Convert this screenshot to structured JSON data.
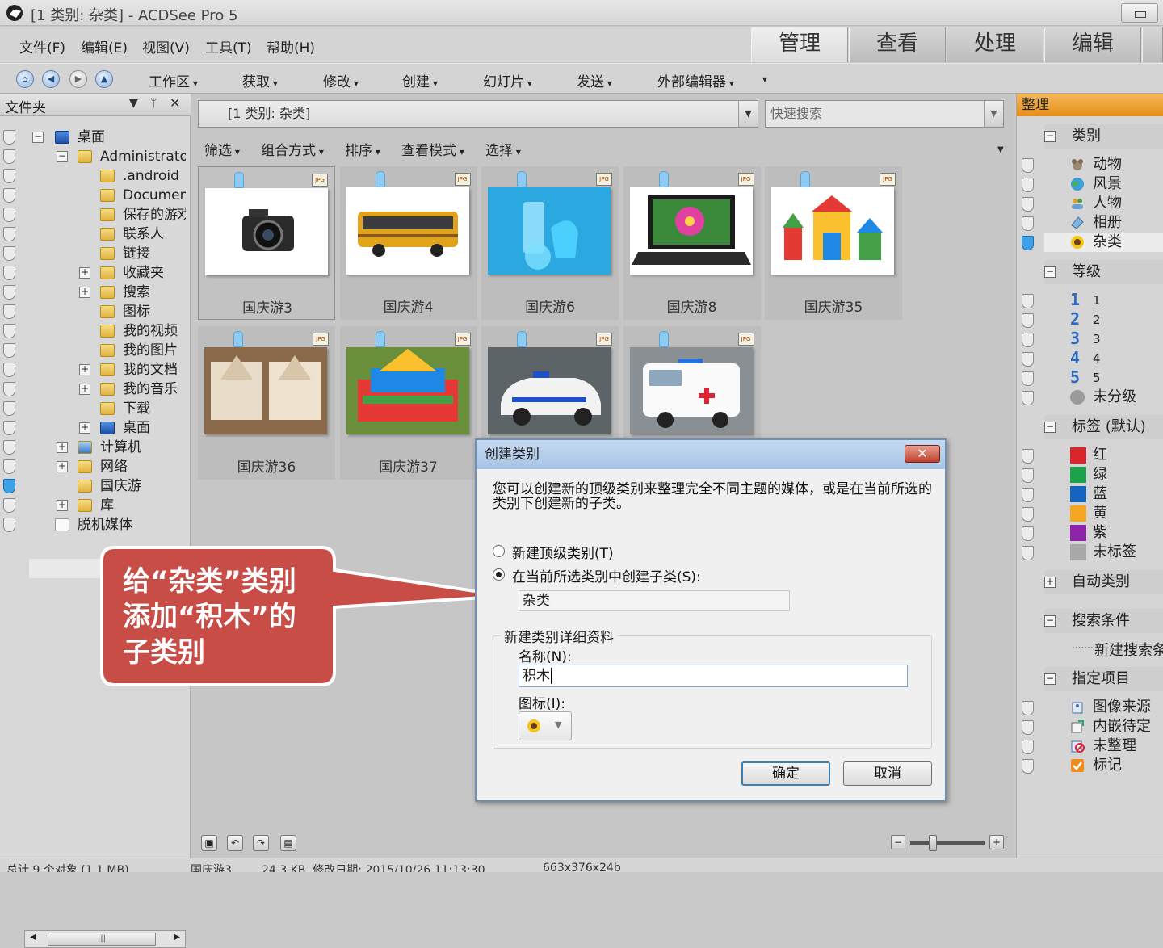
{
  "window": {
    "title": "[1 类别: 杂类] - ACDSee Pro 5"
  },
  "menu": [
    "文件(F)",
    "编辑(E)",
    "视图(V)",
    "工具(T)",
    "帮助(H)"
  ],
  "mode_tabs": [
    "管理",
    "查看",
    "处理",
    "编辑"
  ],
  "toolbar": [
    "工作区",
    "获取",
    "修改",
    "创建",
    "幻灯片",
    "发送",
    "外部编辑器"
  ],
  "folder_panel": {
    "title": "文件夹",
    "tree": [
      {
        "label": "桌面"
      },
      {
        "label": "Administrator"
      },
      {
        "label": ".android"
      },
      {
        "label": "Documents"
      },
      {
        "label": "保存的游戏"
      },
      {
        "label": "联系人"
      },
      {
        "label": "链接"
      },
      {
        "label": "收藏夹"
      },
      {
        "label": "搜索"
      },
      {
        "label": "图标"
      },
      {
        "label": "我的视频"
      },
      {
        "label": "我的图片"
      },
      {
        "label": "我的文档"
      },
      {
        "label": "我的音乐"
      },
      {
        "label": "下载"
      },
      {
        "label": "桌面"
      },
      {
        "label": "计算机"
      },
      {
        "label": "网络"
      },
      {
        "label": "国庆游"
      },
      {
        "label": "库"
      },
      {
        "label": "脱机媒体"
      }
    ]
  },
  "browser": {
    "path": "[1 类别: 杂类]",
    "quicksearch_placeholder": "快速搜索",
    "filters": [
      "筛选",
      "组合方式",
      "排序",
      "查看模式",
      "选择"
    ],
    "thumb_badge": "JPG",
    "thumbnails": [
      {
        "name": "国庆游3",
        "subject": "camera"
      },
      {
        "name": "国庆游4",
        "subject": "bus"
      },
      {
        "name": "国庆游6",
        "subject": "glassware"
      },
      {
        "name": "国庆游8",
        "subject": "laptop"
      },
      {
        "name": "国庆游35",
        "subject": "building-blocks"
      },
      {
        "name": "国庆游36",
        "subject": "carvings"
      },
      {
        "name": "国庆游37",
        "subject": "block-model"
      },
      {
        "name": "",
        "subject": "police-car"
      },
      {
        "name": "",
        "subject": "ambulance"
      }
    ]
  },
  "organize_panel": {
    "title": "整理",
    "sections": {
      "categories": {
        "label": "类别",
        "items": [
          "动物",
          "风景",
          "人物",
          "相册",
          "杂类"
        ]
      },
      "ratings": {
        "label": "等级",
        "items": [
          "1",
          "2",
          "3",
          "4",
          "5"
        ],
        "unrated": "未分级"
      },
      "labels": {
        "label": "标签 (默认)",
        "items": [
          {
            "name": "红",
            "color": "#d9262b"
          },
          {
            "name": "绿",
            "color": "#1aa34a"
          },
          {
            "name": "蓝",
            "color": "#1565c0"
          },
          {
            "name": "黄",
            "color": "#f5a623"
          },
          {
            "name": "紫",
            "color": "#8e24aa"
          },
          {
            "name": "未标签",
            "color": "#a8a8a8"
          }
        ]
      },
      "auto": {
        "label": "自动类别"
      },
      "search": {
        "label": "搜索条件",
        "items": [
          "新建搜索条件"
        ]
      },
      "special": {
        "label": "指定项目",
        "items": [
          "图像来源",
          "内嵌待定",
          "未整理",
          "标记"
        ]
      }
    }
  },
  "dialog": {
    "title": "创建类别",
    "close": "✕",
    "description": "您可以创建新的顶级类别来整理完全不同主题的媒体，或是在当前所选的类别下创建新的子类。",
    "option_top": "新建顶级类别(T)",
    "option_sub": "在当前所选类别中创建子类(S):",
    "parent_value": "杂类",
    "group_title": "新建类别详细资料",
    "name_label": "名称(N):",
    "name_value": "积木",
    "icon_label": "图标(I):",
    "ok": "确定",
    "cancel": "取消"
  },
  "callout": {
    "text": "给“杂类”类别添加“积木”的子类别"
  },
  "status": {
    "total": "总计 9 个对象 (1.1 MB)",
    "file": "国庆游3",
    "info": "24.3 KB, 修改日期: 2015/10/26 11:13:30",
    "dims": "663x376x24b"
  }
}
